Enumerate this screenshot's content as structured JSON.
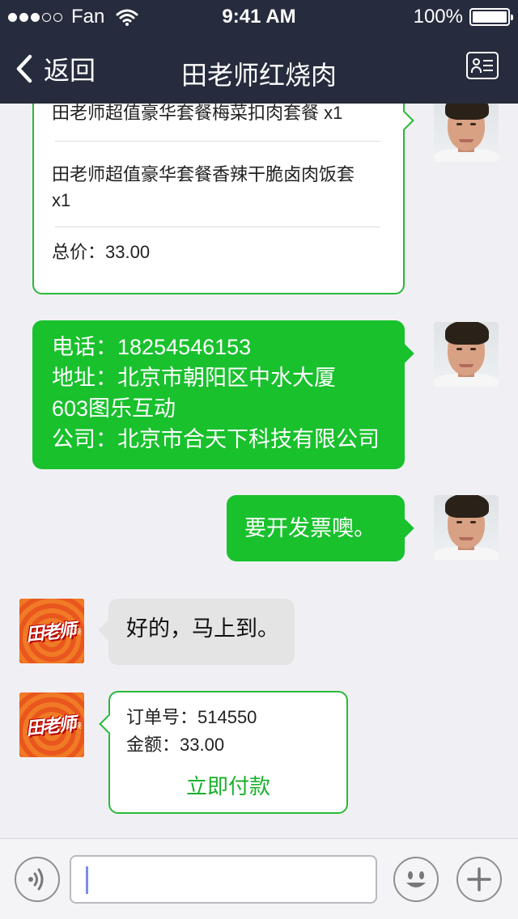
{
  "status_bar": {
    "carrier": "Fan",
    "time": "9:41 AM",
    "battery": "100%",
    "signal_dots": 3
  },
  "nav": {
    "back_label": "返回",
    "title": "田老师红烧肉",
    "contact_icon": "contact-card-icon"
  },
  "messages": {
    "order": {
      "item1": "田老师超值豪华套餐梅菜扣肉套餐 x1",
      "item2_line1": "田老师超值豪华套餐香辣干脆卤肉饭套",
      "item2_line2": "x1",
      "total": "总价：33.00"
    },
    "info": {
      "phone": "电话：18254546153",
      "address_line1": "地址：北京市朝阳区中水大厦",
      "address_line2": "603图乐互动",
      "company": "公司：北京市合天下科技有限公司"
    },
    "invoice": "要开发票噢。",
    "reply": "好的，马上到。",
    "payment": {
      "order_no": "订单号：514550",
      "amount": "金额：33.00",
      "pay_button": "立即付款"
    }
  },
  "merchant_logo": {
    "text": "田老师",
    "sub": "红烧"
  },
  "input_bar": {
    "placeholder": "",
    "voice_icon": "voice-icon",
    "emoji_icon": "emoji-icon",
    "add_icon": "plus-icon"
  },
  "colors": {
    "nav_bg": "#262c3d",
    "bubble_green": "#19c12d",
    "border_green": "#2ab838",
    "chat_bg": "#f0f0f4"
  }
}
